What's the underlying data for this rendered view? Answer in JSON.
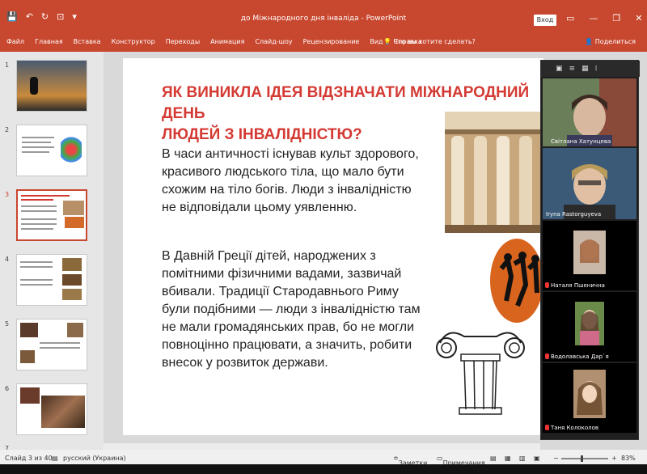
{
  "titlebar": {
    "quick_access": [
      "💾",
      "↶",
      "↻",
      "⊡",
      "▾"
    ],
    "title": "до Міжнародного дня інваліда  -  PowerPoint",
    "sign_in": "Вход",
    "controls": [
      "▭",
      "—",
      "❐",
      "✕"
    ]
  },
  "ribbon": {
    "tabs": [
      "Файл",
      "Главная",
      "Вставка",
      "Конструктор",
      "Переходы",
      "Анимация",
      "Слайд-шоу",
      "Рецензирование",
      "Вид",
      "Справка"
    ],
    "tell_me": "Что вы хотите сделать?",
    "share": "Поделиться"
  },
  "thumbnails": [
    {
      "num": "1"
    },
    {
      "num": "2"
    },
    {
      "num": "3",
      "active": true
    },
    {
      "num": "4"
    },
    {
      "num": "5"
    },
    {
      "num": "6"
    },
    {
      "num": "7"
    }
  ],
  "slide": {
    "title": "ЯК ВИНИКЛА ІДЕЯ ВІДЗНАЧАТИ МІЖНАРОДНИЙ ДЕНЬ\nЛЮДЕЙ З ІНВАЛІДНІСТЮ?",
    "paragraph1": "В часи античності існував культ здорового, красивого людського тіла, що мало бути схожим на тіло богів. Люди з інвалідністю не відповідали цьому уявленню.",
    "paragraph2": "В Давній Греції дітей, народжених з помітними фізичними вадами, зазвичай вбивали. Традиції Стародавнього Риму були подібними — люди з інвалідністю там не мали громадянських прав, бо не могли повноцінно працювати, а значить, робити внесок у розвиток держави."
  },
  "zoom": {
    "toolbar_icons": [
      "▣",
      "≡",
      "▦",
      "⁞"
    ],
    "participants": [
      {
        "name": "Світлана Хатунцева",
        "muted": false
      },
      {
        "name": "Iryna Rastorguyeva",
        "muted": false
      },
      {
        "name": "Наталя Пшенична",
        "muted": true
      },
      {
        "name": "Водолавська Дар`я",
        "muted": true
      },
      {
        "name": "Таня Колоколов",
        "muted": true
      }
    ]
  },
  "status": {
    "slide_info": "Слайд 3 из 40",
    "language": "русский (Украина)",
    "notes": "Заметки",
    "comments": "Примечания",
    "zoom": "83%",
    "view_icons": [
      "▤",
      "▦",
      "▥",
      "▣"
    ]
  },
  "colors": {
    "accent": "#c8472f",
    "title_red": "#d43a33"
  }
}
